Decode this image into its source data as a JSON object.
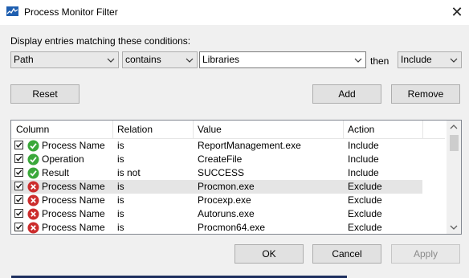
{
  "window": {
    "title": "Process Monitor Filter",
    "close_glyph": "✕"
  },
  "prompt": "Display entries matching these conditions:",
  "conditions": {
    "column": "Path",
    "relation": "contains",
    "value": "Libraries",
    "then_label": "then",
    "action": "Include"
  },
  "buttons": {
    "reset": "Reset",
    "add": "Add",
    "remove": "Remove",
    "ok": "OK",
    "cancel": "Cancel",
    "apply": "Apply"
  },
  "table": {
    "headers": [
      "Column",
      "Relation",
      "Value",
      "Action"
    ],
    "rows": [
      {
        "column": "Process Name",
        "relation": "is",
        "value": "ReportManagement.exe",
        "action": "Include",
        "status": "include",
        "checked": true
      },
      {
        "column": "Operation",
        "relation": "is",
        "value": "CreateFile",
        "action": "Include",
        "status": "include",
        "checked": true
      },
      {
        "column": "Result",
        "relation": "is not",
        "value": "SUCCESS",
        "action": "Include",
        "status": "include",
        "checked": true
      },
      {
        "column": "Process Name",
        "relation": "is",
        "value": "Procmon.exe",
        "action": "Exclude",
        "status": "exclude",
        "checked": true,
        "selected": true
      },
      {
        "column": "Process Name",
        "relation": "is",
        "value": "Procexp.exe",
        "action": "Exclude",
        "status": "exclude",
        "checked": true
      },
      {
        "column": "Process Name",
        "relation": "is",
        "value": "Autoruns.exe",
        "action": "Exclude",
        "status": "exclude",
        "checked": true
      },
      {
        "column": "Process Name",
        "relation": "is",
        "value": "Procmon64.exe",
        "action": "Exclude",
        "status": "exclude",
        "checked": true
      }
    ]
  },
  "colors": {
    "include": "#3aa83a",
    "exclude": "#cc2d2d",
    "selected_row": "#e5e5e5",
    "accent": "#1d2e5e"
  }
}
